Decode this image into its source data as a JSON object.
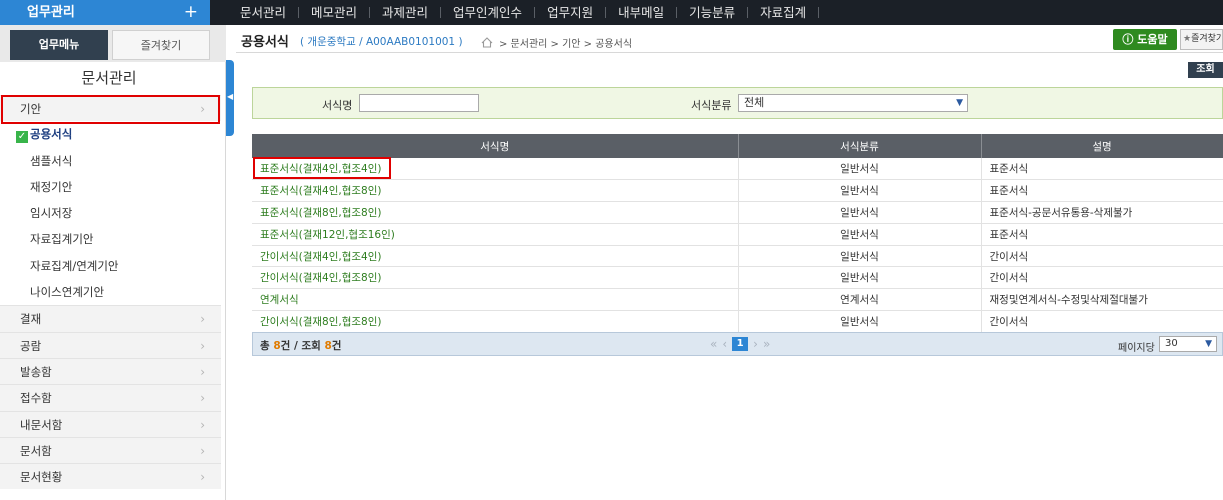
{
  "topbar": {
    "menu_head": "업무관리",
    "plus": "+",
    "nav": [
      "문서관리",
      "메모관리",
      "과제관리",
      "업무인계인수",
      "업무지원",
      "내부메일",
      "기능분류",
      "자료집계"
    ]
  },
  "sidebar": {
    "tab_work": "업무메뉴",
    "tab_fav": "즐겨찾기",
    "title": "문서관리",
    "items": [
      {
        "label": "기안",
        "type": "cat"
      },
      {
        "label": "공용서식",
        "type": "sub-selected"
      },
      {
        "label": "샘플서식",
        "type": "sub"
      },
      {
        "label": "재정기안",
        "type": "sub"
      },
      {
        "label": "임시저장",
        "type": "sub"
      },
      {
        "label": "자료집계기안",
        "type": "sub"
      },
      {
        "label": "자료집계/연계기안",
        "type": "sub"
      },
      {
        "label": "나이스연계기안",
        "type": "sub"
      },
      {
        "label": "결재",
        "type": "cat"
      },
      {
        "label": "공람",
        "type": "cat"
      },
      {
        "label": "발송함",
        "type": "cat"
      },
      {
        "label": "접수함",
        "type": "cat"
      },
      {
        "label": "내문서함",
        "type": "cat"
      },
      {
        "label": "문서함",
        "type": "cat"
      },
      {
        "label": "문서현황",
        "type": "cat"
      }
    ]
  },
  "header": {
    "title": "공용서식",
    "school": "( 개운중학교  /  A00AAB0101001  )",
    "breadcrumb": "> 문서관리 > 기안 > 공용서식",
    "help": "도움말",
    "fav": "즐겨찾기",
    "view": "조회"
  },
  "search": {
    "name_label": "서식명",
    "name_value": "",
    "cat_label": "서식분류",
    "cat_value": "전체"
  },
  "grid": {
    "columns": [
      "서식명",
      "서식분류",
      "설명"
    ],
    "rows": [
      [
        "표준서식(결재4인,협조4인)",
        "일반서식",
        "표준서식"
      ],
      [
        "표준서식(결재4인,협조8인)",
        "일반서식",
        "표준서식"
      ],
      [
        "표준서식(결재8인,협조8인)",
        "일반서식",
        "표준서식-공문서유통용-삭제불가"
      ],
      [
        "표준서식(결재12인,협조16인)",
        "일반서식",
        "표준서식"
      ],
      [
        "간이서식(결재4인,협조4인)",
        "일반서식",
        "간이서식"
      ],
      [
        "간이서식(결재4인,협조8인)",
        "일반서식",
        "간이서식"
      ],
      [
        "연계서식",
        "연계서식",
        "재정및연계서식-수정및삭제절대불가"
      ],
      [
        "간이서식(결재8인,협조8인)",
        "일반서식",
        "간이서식"
      ]
    ]
  },
  "footer": {
    "total_prefix": "총 ",
    "total_count": "8",
    "total_mid": "건 / 조회 ",
    "view_count": "8",
    "total_suffix": "건",
    "page": "1",
    "page_size_label": "페이지당",
    "page_size": "30"
  }
}
